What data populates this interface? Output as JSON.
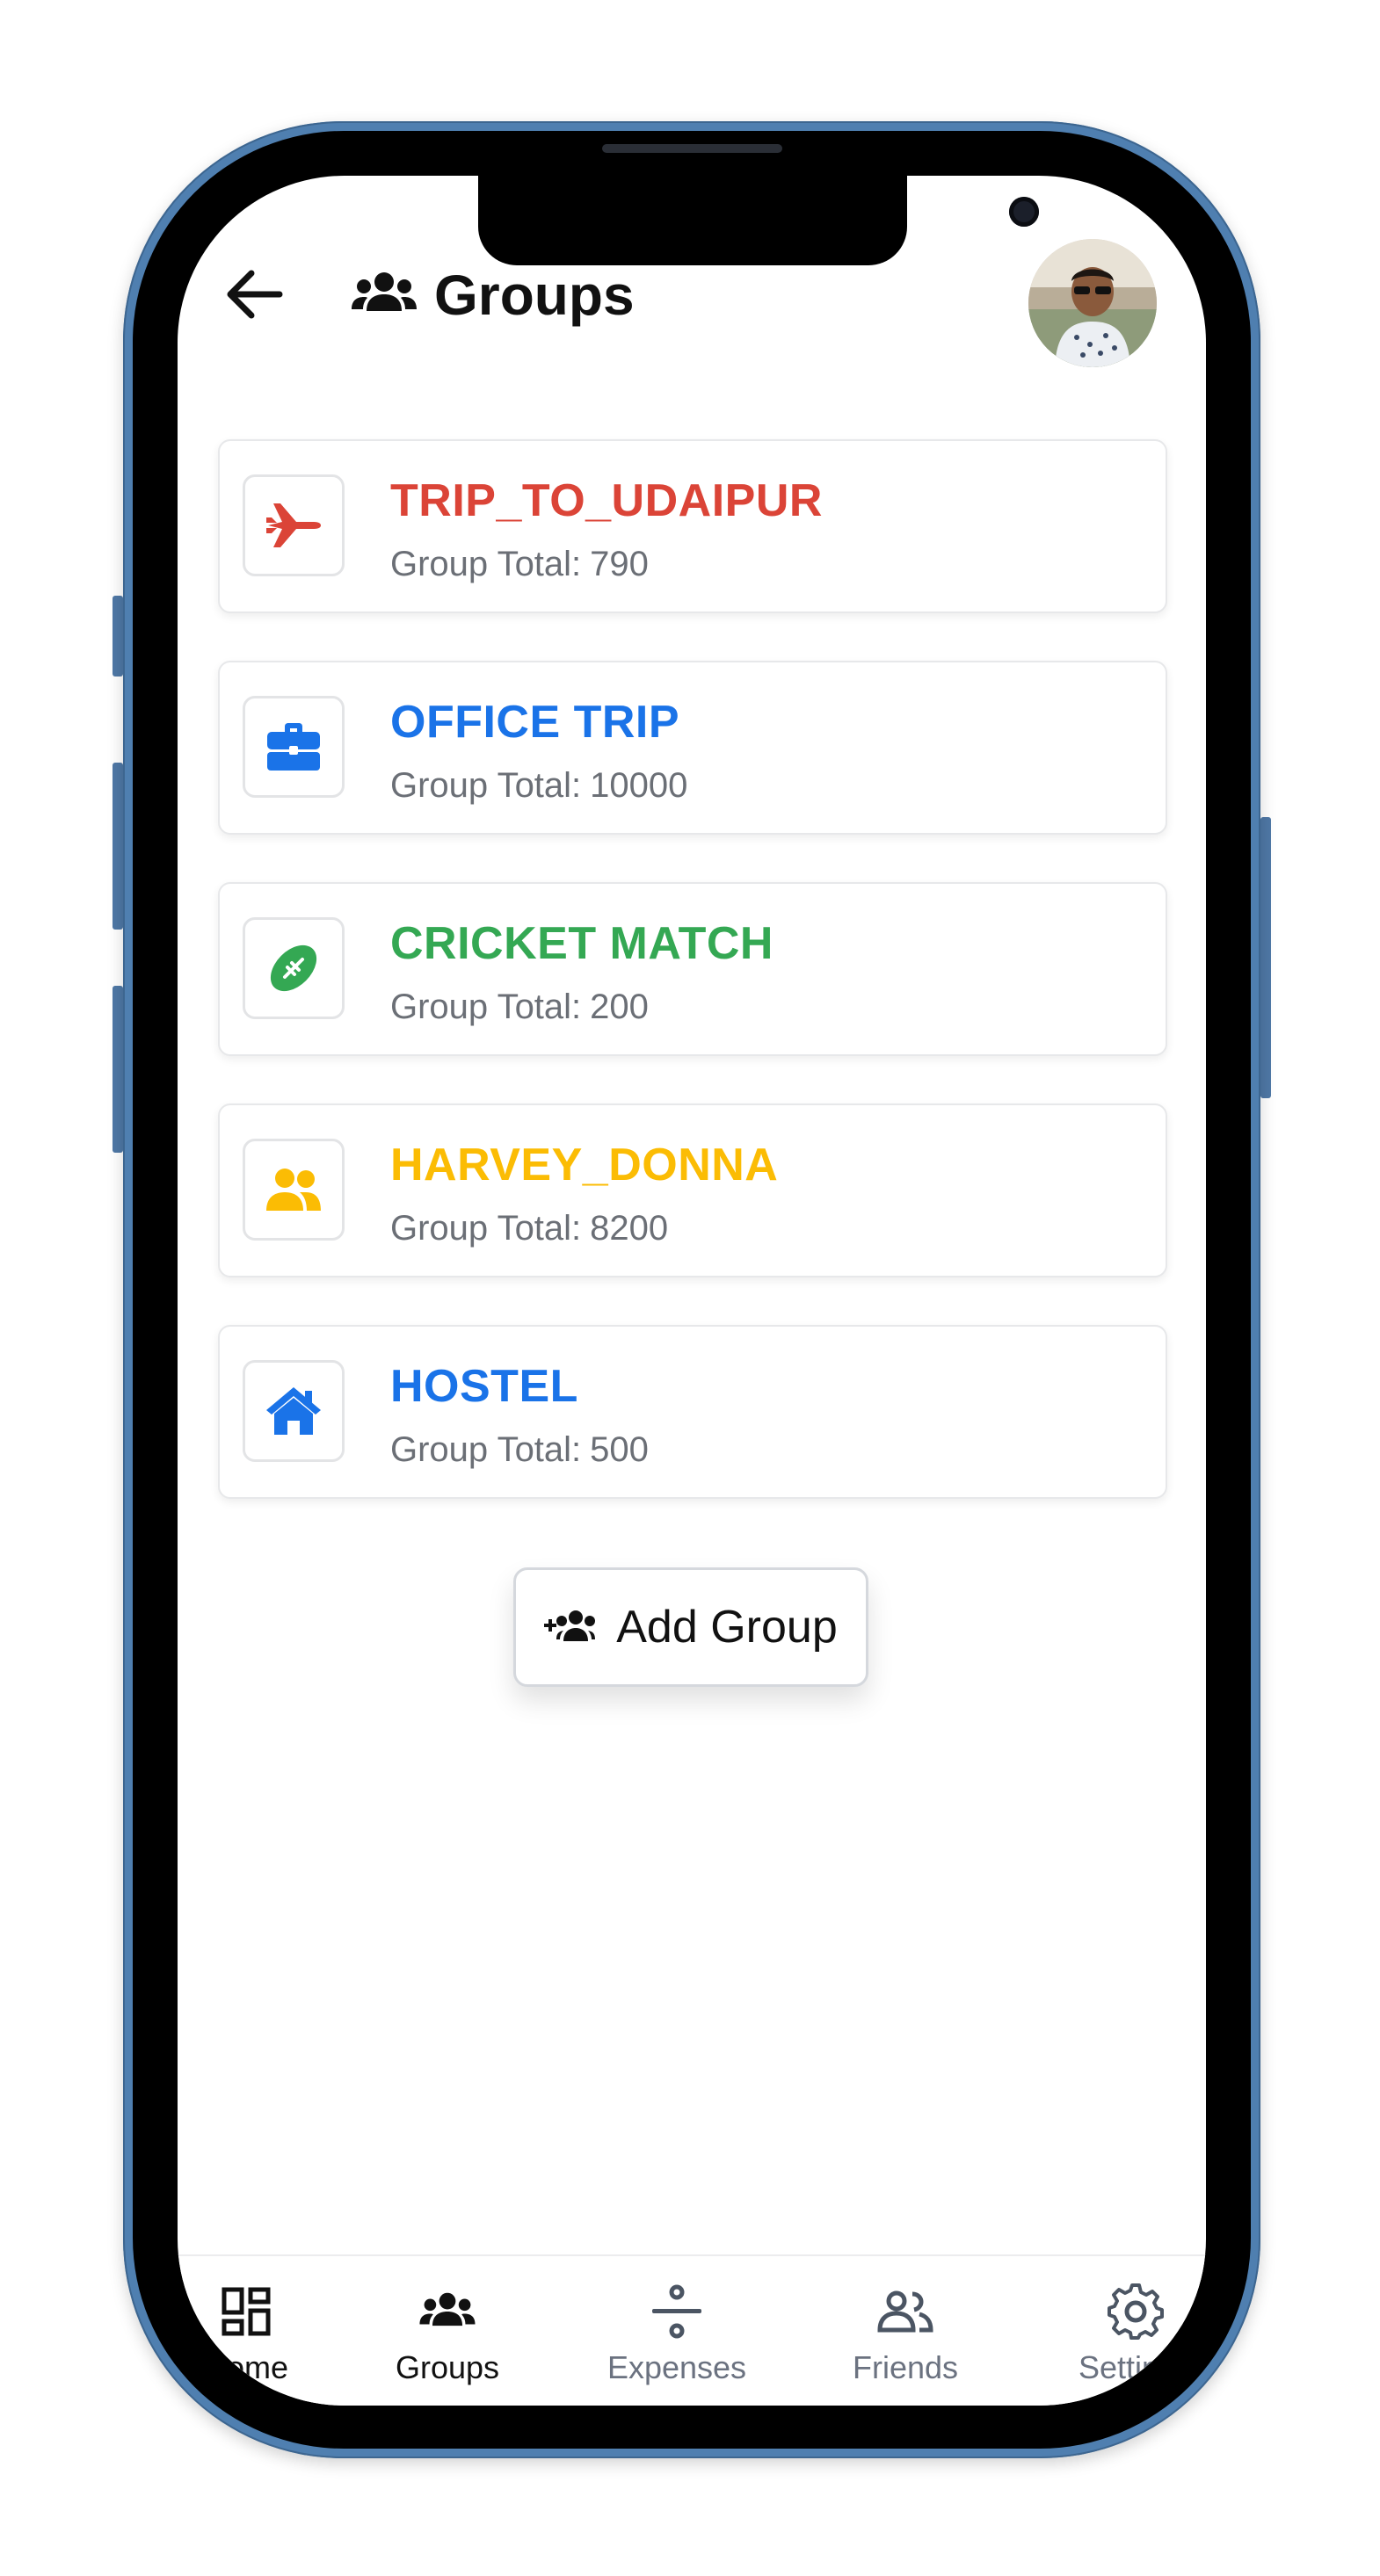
{
  "header": {
    "title": "Groups",
    "back_icon": "arrow-left-icon",
    "title_icon": "users-icon"
  },
  "groups": [
    {
      "name": "TRIP_TO_UDAIPUR",
      "total_label": "Group Total:",
      "total": "790",
      "color": "#db4437",
      "icon": "plane-icon"
    },
    {
      "name": "OFFICE TRIP",
      "total_label": "Group Total:",
      "total": "10000",
      "color": "#1a73e8",
      "icon": "briefcase-icon"
    },
    {
      "name": "CRICKET MATCH",
      "total_label": "Group Total:",
      "total": "200",
      "color": "#34a853",
      "icon": "football-icon"
    },
    {
      "name": "HARVEY_DONNA",
      "total_label": "Group Total:",
      "total": "8200",
      "color": "#fbbc04",
      "icon": "user-group-icon"
    },
    {
      "name": "HOSTEL",
      "total_label": "Group Total:",
      "total": "500",
      "color": "#1a73e8",
      "icon": "house-icon"
    }
  ],
  "add_group": {
    "label": "Add Group",
    "icon": "user-plus-group-icon"
  },
  "nav": [
    {
      "label": "Home",
      "icon": "grid-icon",
      "active": false
    },
    {
      "label": "Groups",
      "icon": "users-icon",
      "active": true
    },
    {
      "label": "Expenses",
      "icon": "divide-icon",
      "active": false
    },
    {
      "label": "Friends",
      "icon": "friends-icon",
      "active": false
    },
    {
      "label": "Settings",
      "icon": "gear-icon",
      "active": false
    }
  ]
}
